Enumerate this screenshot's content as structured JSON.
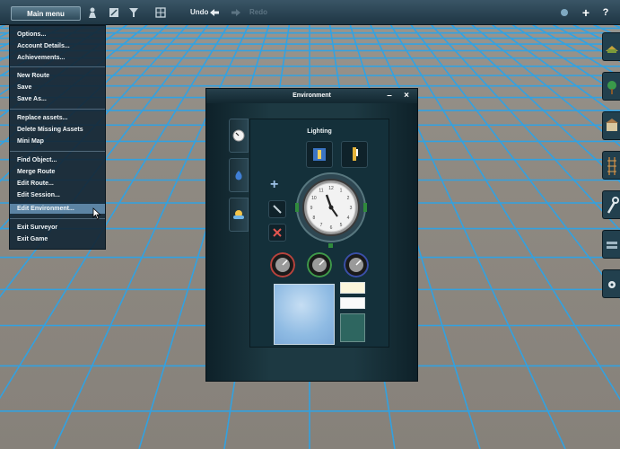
{
  "toolbar": {
    "main_menu": "Main menu",
    "undo": "Undo",
    "redo": "Redo",
    "plus": "+",
    "help": "?"
  },
  "menu": {
    "items": [
      "Options...",
      "Account Details...",
      "Achievements...",
      "New Route",
      "Save",
      "Save As...",
      "Replace assets...",
      "Delete Missing Assets",
      "Mini Map",
      "Find Object...",
      "Merge Route",
      "Edit Route...",
      "Edit Session...",
      "Edit Environment...",
      "Exit Surveyor",
      "Exit Game"
    ],
    "highlighted": "Edit Environment..."
  },
  "dialog": {
    "title": "Environment",
    "minimize": "–",
    "close": "×",
    "section_label": "Lighting",
    "add_symbol": "+",
    "clock_numbers": [
      "12",
      "1",
      "2",
      "3",
      "4",
      "5",
      "6",
      "7",
      "8",
      "9",
      "10",
      "11"
    ]
  },
  "colors": {
    "accent": "#5c84a4",
    "grid_line": "#2ea3e6",
    "tile": "#8f8a82",
    "sky": "#9cc6ea",
    "swatch_1": "#fbf6dc",
    "swatch_2": "#fafafa",
    "swatch_3": "#2e6660"
  },
  "icons": {
    "toolbar": [
      "person-icon",
      "paint-icon",
      "filter-icon",
      "grid-icon",
      "undo-arrow-icon",
      "redo-arrow-icon",
      "sun-icon"
    ],
    "side_tabs": [
      "clock-tab-icon",
      "water-tab-icon",
      "weather-tab-icon"
    ],
    "right_bar": [
      "terrain-paint-icon",
      "tree-icon",
      "building-icon",
      "track-icon",
      "wrench-icon",
      "layers-icon",
      "settings-icon"
    ]
  }
}
